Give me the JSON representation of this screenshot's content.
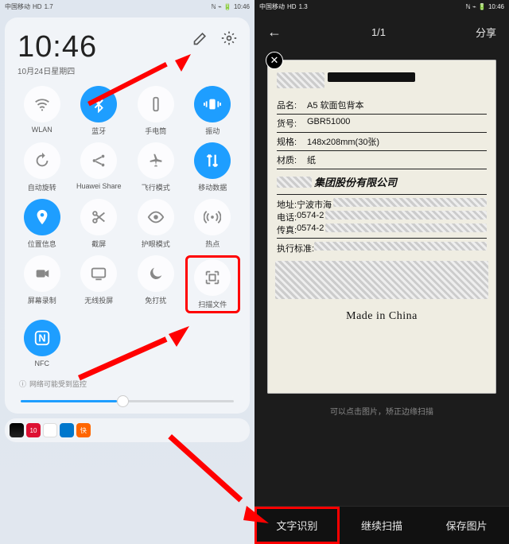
{
  "left": {
    "status": {
      "carrier1": "中国移动",
      "carrier2": "中国移动",
      "net": "⁴⁶",
      "speed": "1.7",
      "unit": "K/s",
      "batt": "■■■4▸",
      "time": "10:46"
    },
    "clock": "10:46",
    "date": "10月24日星期四",
    "tiles": [
      {
        "label": "WLAN",
        "on": false,
        "icon": "wifi"
      },
      {
        "label": "蓝牙",
        "on": true,
        "icon": "bt"
      },
      {
        "label": "手电筒",
        "on": false,
        "icon": "torch"
      },
      {
        "label": "振动",
        "on": true,
        "icon": "vib"
      },
      {
        "label": "自动旋转",
        "on": false,
        "icon": "rotate"
      },
      {
        "label": "Huawei Share",
        "on": false,
        "icon": "share"
      },
      {
        "label": "飞行模式",
        "on": false,
        "icon": "plane"
      },
      {
        "label": "移动数据",
        "on": true,
        "icon": "data"
      },
      {
        "label": "位置信息",
        "on": true,
        "icon": "pin"
      },
      {
        "label": "截屏",
        "on": false,
        "icon": "scissors"
      },
      {
        "label": "护眼模式",
        "on": false,
        "icon": "eye"
      },
      {
        "label": "热点",
        "on": false,
        "icon": "hotspot"
      },
      {
        "label": "屏幕录制",
        "on": false,
        "icon": "record"
      },
      {
        "label": "无线投屏",
        "on": false,
        "icon": "cast"
      },
      {
        "label": "免打扰",
        "on": false,
        "icon": "moon"
      },
      {
        "label": "扫描文件",
        "on": false,
        "icon": "scan",
        "hl": true
      },
      {
        "label": "NFC",
        "on": true,
        "icon": "nfc"
      }
    ],
    "warning": "网络可能受到监控"
  },
  "right": {
    "status": {
      "carrier1": "中国移动",
      "carrier2": "中国移动",
      "net": "⁴⁶",
      "speed": "1.3",
      "unit": "K/s",
      "batt": "■■■4▸",
      "time": "10:46"
    },
    "header": {
      "count": "1/1",
      "share": "分享"
    },
    "label": {
      "f1k": "品名:",
      "f1v": "A5 软面包背本",
      "f2k": "货号:",
      "f2v": "GBR51000",
      "f3k": "规格:",
      "f3v": "148x208mm(30张)",
      "f4k": "材质:",
      "f4v": "纸",
      "company": "集团股份有限公司",
      "addr_k": "地址:",
      "addr_v": "宁波市海",
      "tel_k": "电话:",
      "tel_v": "0574-2",
      "fax_k": "传真:",
      "fax_v": "0574-2",
      "std_k": "执行标准:",
      "mic": "Made in China"
    },
    "hint": "可以点击图片，矫正边缘扫描",
    "actions": {
      "a1": "文字识别",
      "a2": "继续扫描",
      "a3": "保存图片"
    }
  }
}
